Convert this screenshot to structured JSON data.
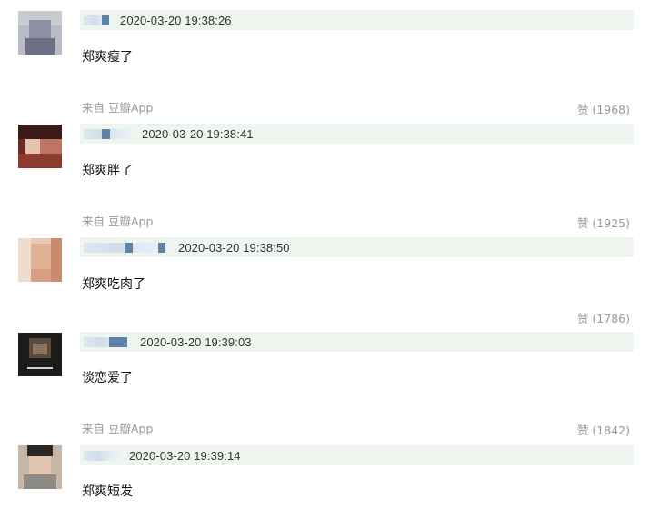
{
  "comments": [
    {
      "time": "2020-03-20 19:38:26",
      "text": "郑爽瘦了",
      "source": "来自 豆瓣App",
      "likes": "赞 (1968)"
    },
    {
      "time": "2020-03-20 19:38:41",
      "text": "郑爽胖了",
      "source": "来自 豆瓣App",
      "likes": "赞 (1925)"
    },
    {
      "time": "2020-03-20 19:38:50",
      "text": "郑爽吃肉了",
      "source": "",
      "likes": "赞 (1786)"
    },
    {
      "time": "2020-03-20 19:39:03",
      "text": "谈恋爱了",
      "source": "来自 豆瓣App",
      "likes": "赞 (1842)"
    },
    {
      "time": "2020-03-20 19:39:14",
      "text": "郑爽短发",
      "source": "",
      "likes": ""
    }
  ]
}
